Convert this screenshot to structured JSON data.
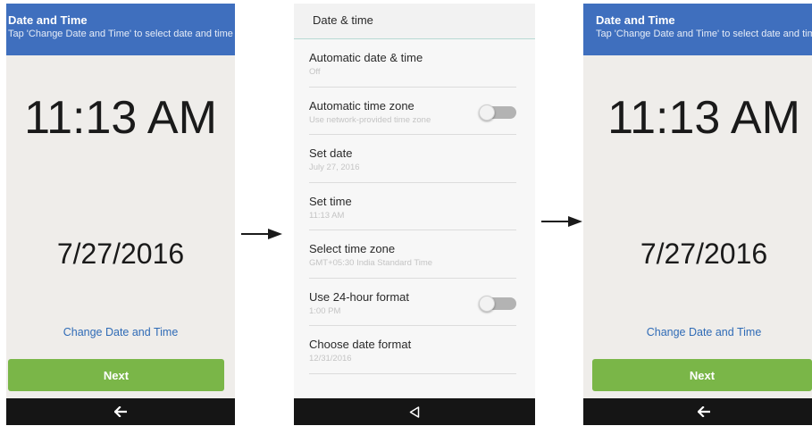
{
  "left_screen": {
    "header_title": "Date and Time",
    "header_subtitle": "Tap 'Change Date and Time' to select date and time",
    "time": "11:13 AM",
    "date": "7/27/2016",
    "change_link": "Change Date and Time",
    "next_button": "Next",
    "back_icon": "back-arrow-icon"
  },
  "settings_screen": {
    "header_title": "Date & time",
    "items": [
      {
        "title": "Automatic date & time",
        "subtitle": "Off",
        "toggle": false
      },
      {
        "title": "Automatic time zone",
        "subtitle": "Use network-provided time zone",
        "toggle": true,
        "toggle_on": false
      },
      {
        "title": "Set date",
        "subtitle": "July 27, 2016",
        "toggle": false
      },
      {
        "title": "Set time",
        "subtitle": "11:13 AM",
        "toggle": false
      },
      {
        "title": "Select time zone",
        "subtitle": "GMT+05:30 India Standard Time",
        "toggle": false
      },
      {
        "title": "Use 24-hour format",
        "subtitle": "1:00 PM",
        "toggle": true,
        "toggle_on": false
      },
      {
        "title": "Choose date format",
        "subtitle": "12/31/2016",
        "toggle": false
      }
    ],
    "nav_icon": "triangle-back-icon"
  },
  "right_screen": {
    "header_title": "Date and Time",
    "header_subtitle": "Tap 'Change Date and Time' to select date and time",
    "time": "11:13 AM",
    "date": "7/27/2016",
    "change_link": "Change Date and Time",
    "next_button": "Next",
    "back_icon": "back-arrow-icon"
  },
  "flow_arrows": [
    "right-arrow-icon",
    "right-arrow-icon"
  ],
  "colors": {
    "header_blue": "#3f6fbe",
    "next_green": "#7ab648",
    "link_blue": "#2f6bb6",
    "nav_bar": "#151515"
  }
}
